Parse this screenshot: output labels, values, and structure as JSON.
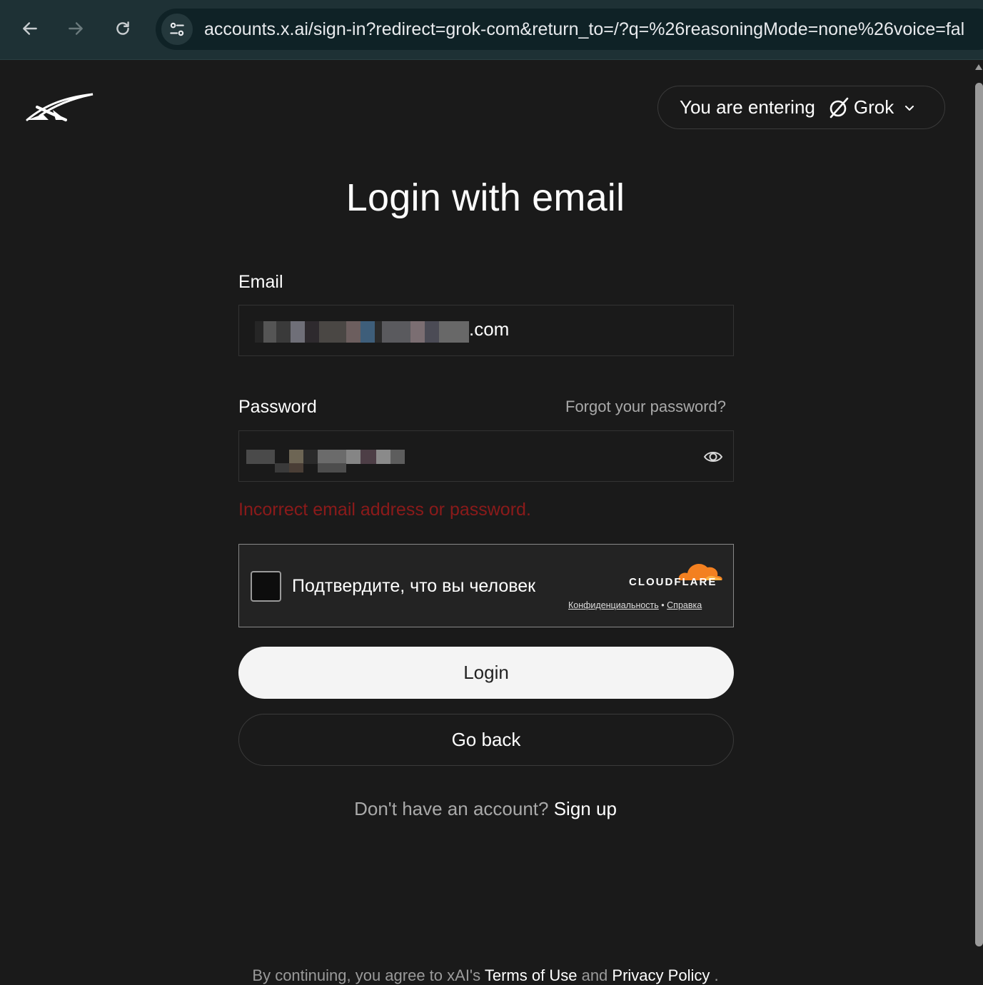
{
  "browser": {
    "url": "accounts.x.ai/sign-in?redirect=grok-com&return_to=/?q=%26reasoningMode=none%26voice=fal",
    "back_icon": "arrow-left-icon",
    "forward_icon": "arrow-right-icon",
    "reload_icon": "reload-icon",
    "site_info_icon": "tune-icon"
  },
  "header": {
    "logo_icon": "xai-logo",
    "entering_label": "You are entering",
    "product_name": "Grok",
    "product_icon": "grok-icon"
  },
  "page": {
    "title": "Login with email"
  },
  "form": {
    "email_label": "Email",
    "email_visible_suffix": ".com",
    "password_label": "Password",
    "forgot_password": "Forgot your password?",
    "error_message": "Incorrect email address or password.",
    "captcha": {
      "text": "Подтвердите, что вы человек",
      "brand": "CLOUDFLARE",
      "privacy_link": "Конфиденциальность",
      "separator": "•",
      "help_link": "Справка"
    },
    "login_button": "Login",
    "go_back_button": "Go back"
  },
  "signup": {
    "prompt": "Don't have an account?",
    "link": "Sign up"
  },
  "footer": {
    "prefix": "By continuing, you agree to xAI's",
    "terms": "Terms of Use",
    "and": "and",
    "privacy": "Privacy Policy",
    "suffix": "."
  },
  "colors": {
    "background": "#1a1a1a",
    "browser_bar": "#1e3135",
    "error": "#8b1a1a",
    "cloudflare_orange": "#f38020"
  }
}
